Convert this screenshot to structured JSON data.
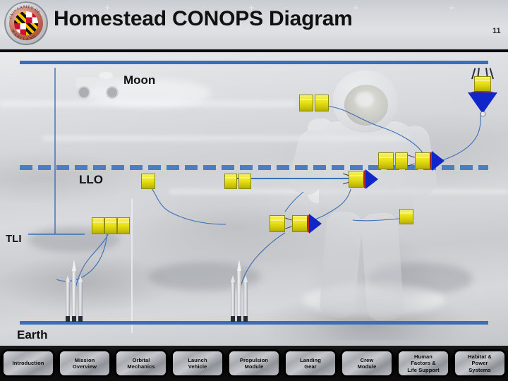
{
  "slide": {
    "title": "Homestead CONOPS Diagram",
    "page_number": "11",
    "logo_name": "university-of-maryland-seal"
  },
  "diagram": {
    "labels": {
      "moon": "Moon",
      "llo": "LLO",
      "tli": "TLI",
      "earth": "Earth"
    },
    "orbit_lines": [
      {
        "name": "moon-surface-line",
        "style": "solid",
        "color": "#3a6fb5"
      },
      {
        "name": "llo-orbit-line",
        "style": "dashed",
        "color": "#4a7ec0"
      },
      {
        "name": "earth-surface-line",
        "style": "solid",
        "color": "#3a6fb5"
      }
    ],
    "element_colors": {
      "module_yellow": "#e8e014",
      "engine_blue": "#1026c8",
      "heat_band_red": "#9b1b14",
      "trajectory_blue": "#3a6fb5"
    },
    "vehicles": [
      {
        "name": "lunar-lander",
        "modules": 1,
        "has_engine": true,
        "has_legs": true
      },
      {
        "name": "llo-module-pair-upper",
        "modules": 2,
        "has_engine": false
      },
      {
        "name": "llo-stack-right",
        "modules": 3,
        "has_engine": true
      },
      {
        "name": "llo-module-single-left",
        "modules": 1,
        "has_engine": false
      },
      {
        "name": "llo-module-pair-mid",
        "modules": 2,
        "has_engine": false
      },
      {
        "name": "llo-lander-descending",
        "modules": 1,
        "has_engine": true
      },
      {
        "name": "tli-stack-left",
        "modules": 3,
        "has_engine": false
      },
      {
        "name": "tli-stack-mid",
        "modules": 2,
        "has_engine": true
      },
      {
        "name": "tli-module-right",
        "modules": 1,
        "has_engine": false
      }
    ],
    "launch_vehicles": [
      {
        "name": "launch-vehicle-left",
        "boosters": 2
      },
      {
        "name": "launch-vehicle-right",
        "boosters": 2
      }
    ]
  },
  "nav": {
    "items": [
      {
        "label": "Introduction",
        "name": "nav-introduction"
      },
      {
        "label": "Mission\nOverview",
        "name": "nav-mission-overview"
      },
      {
        "label": "Orbital\nMechanics",
        "name": "nav-orbital-mechanics"
      },
      {
        "label": "Launch\nVehicle",
        "name": "nav-launch-vehicle"
      },
      {
        "label": "Propulsion\nModule",
        "name": "nav-propulsion-module"
      },
      {
        "label": "Landing\nGear",
        "name": "nav-landing-gear"
      },
      {
        "label": "Crew\nModule",
        "name": "nav-crew-module"
      },
      {
        "label": "Human\nFactors &\nLife Support",
        "name": "nav-human-factors-life-support"
      },
      {
        "label": "Habitat &\nPower\nSystems",
        "name": "nav-habitat-power-systems"
      }
    ]
  }
}
